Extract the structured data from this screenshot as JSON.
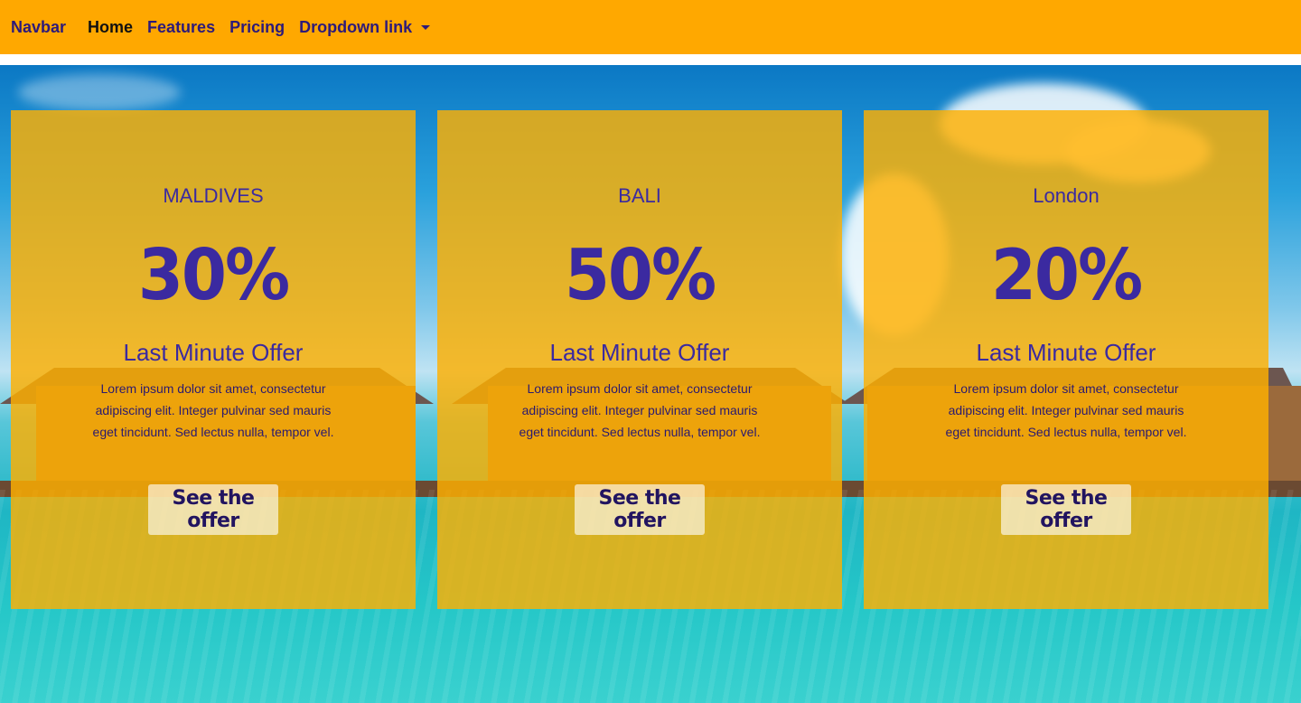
{
  "navbar": {
    "brand": "Navbar",
    "links": [
      {
        "label": "Home"
      },
      {
        "label": "Features"
      },
      {
        "label": "Pricing"
      },
      {
        "label": "Dropdown link"
      }
    ]
  },
  "cards": [
    {
      "destination": "MALDIVES",
      "discount": "30%",
      "offer_title": "Last Minute Offer",
      "description": "Lorem ipsum dolor sit amet, consectetur adipiscing elit. Integer pulvinar sed mauris eget tincidunt. Sed lectus nulla, tempor vel.",
      "button_label": "See the offer"
    },
    {
      "destination": "BALI",
      "discount": "50%",
      "offer_title": "Last Minute Offer",
      "description": "Lorem ipsum dolor sit amet, consectetur adipiscing elit. Integer pulvinar sed mauris eget tincidunt. Sed lectus nulla, tempor vel.",
      "button_label": "See the offer"
    },
    {
      "destination": "London",
      "discount": "20%",
      "offer_title": "Last Minute Offer",
      "description": "Lorem ipsum dolor sit amet, consectetur adipiscing elit. Integer pulvinar sed mauris eget tincidunt. Sed lectus nulla, tempor vel.",
      "button_label": "See the offer"
    }
  ],
  "colors": {
    "navbar_bg": "#ffa800",
    "card_bg": "#ffb000",
    "text_accent": "#3b2aa0"
  }
}
